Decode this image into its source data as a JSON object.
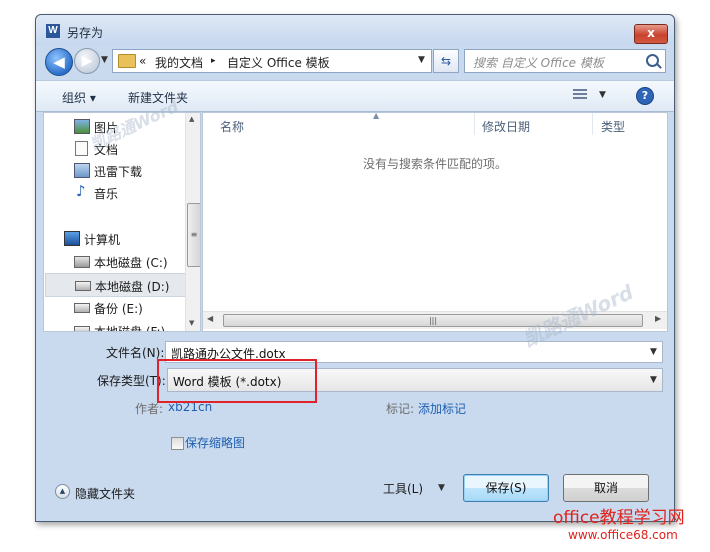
{
  "window": {
    "title": "另存为",
    "app_icon": "word-icon",
    "close_label": "x"
  },
  "nav": {
    "path_prefix": "«",
    "path": [
      "我的文档",
      "自定义 Office 模板"
    ],
    "separator": "▸",
    "search_placeholder": "搜索 自定义 Office 模板"
  },
  "toolbar": {
    "organize": "组织 ▾",
    "new_folder": "新建文件夹"
  },
  "sidebar": {
    "items": [
      {
        "label": "图片",
        "icon": "pictures-icon"
      },
      {
        "label": "文档",
        "icon": "documents-icon"
      },
      {
        "label": "迅雷下载",
        "icon": "download-folder-icon"
      },
      {
        "label": "音乐",
        "icon": "music-icon"
      },
      {
        "label": "计算机",
        "icon": "computer-icon"
      },
      {
        "label": "本地磁盘 (C:)",
        "icon": "system-drive-icon"
      },
      {
        "label": "本地磁盘 (D:)",
        "icon": "drive-icon",
        "selected": true
      },
      {
        "label": "备份 (E:)",
        "icon": "drive-icon"
      },
      {
        "label": "本地磁盘 (F:)",
        "icon": "drive-icon"
      }
    ]
  },
  "files": {
    "columns": [
      "名称",
      "修改日期",
      "类型"
    ],
    "empty_message": "没有与搜索条件匹配的项。"
  },
  "form": {
    "filename_label": "文件名(N):",
    "filename_value": "凯路通办公文件.dotx",
    "filetype_label": "保存类型(T):",
    "filetype_value": "Word 模板 (*.dotx)",
    "author_label": "作者:",
    "author_value": "xb21cn",
    "tags_label": "标记:",
    "tags_value": "添加标记",
    "thumbnail_label": "保存缩略图"
  },
  "footer": {
    "hide_folders": "隐藏文件夹",
    "tools": "工具(L)",
    "save": "保存(S)",
    "cancel": "取消"
  },
  "watermarks": {
    "text": "凯路通Word"
  },
  "branding": {
    "line1": "office教程学习网",
    "line2": "www.office68.com"
  },
  "colors": {
    "highlight_box": "#e0222a",
    "link": "#1f5fb1",
    "brand": "#e0221b"
  }
}
